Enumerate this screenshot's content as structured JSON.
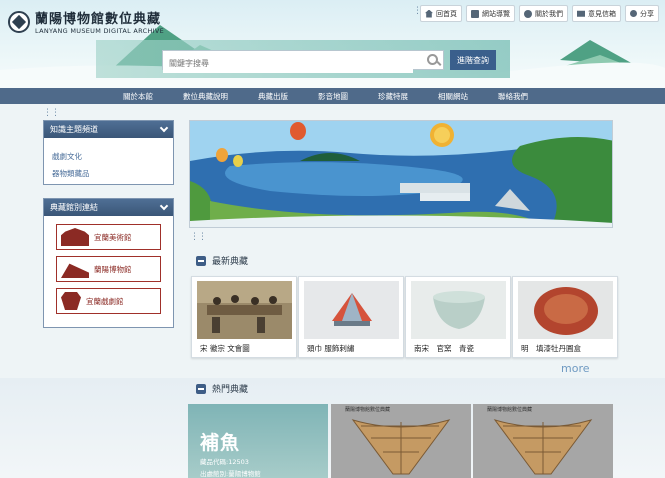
{
  "site": {
    "title_cn": "蘭陽博物館數位典藏",
    "title_en": "LANYANG MUSEUM DIGITAL ARCHIVE"
  },
  "top_buttons": [
    {
      "label": "回首頁",
      "icon": "home-icon"
    },
    {
      "label": "網站導覽",
      "icon": "sitemap-icon"
    },
    {
      "label": "關於我們",
      "icon": "info-icon"
    },
    {
      "label": "意見信箱",
      "icon": "mail-icon"
    },
    {
      "label": "分享",
      "icon": "share-icon"
    }
  ],
  "search": {
    "placeholder": "關鍵字搜尋",
    "advanced_label": "進階查詢"
  },
  "nav": [
    "關於本館",
    "數位典藏說明",
    "典藏出版",
    "影音地圖",
    "珍藏特展",
    "相關網站",
    "聯絡我們"
  ],
  "sidebar": {
    "topics_title": "知識主題頻道",
    "topics": [
      "戲劇文化",
      "器物類藏品"
    ],
    "venues_title": "典藏館別連結",
    "venues": [
      "宜蘭美術館",
      "蘭陽博物館",
      "宜蘭戲劇館"
    ]
  },
  "latest": {
    "title": "最新典藏",
    "items": [
      {
        "caption": "宋 徽宗 文會圖"
      },
      {
        "caption": "頭巾 服飾刺繡"
      },
      {
        "caption": "南宋　官窯　青瓷"
      },
      {
        "caption": "明　填漆牡丹圓盒"
      }
    ],
    "more_label": "more"
  },
  "hot": {
    "title": "熱門典藏",
    "feature_name": "補魚",
    "feature_code": "藏品代碼:12503",
    "feature_org": "出處館別:蘭陽博物館",
    "thumb_caption": "蘭陽博物館數位典藏"
  },
  "colors": {
    "nav_bg": "#4f6a8a",
    "panel_head": "#3a5677",
    "venue_red": "#8b2a24",
    "more_link": "#6f9ac2"
  }
}
